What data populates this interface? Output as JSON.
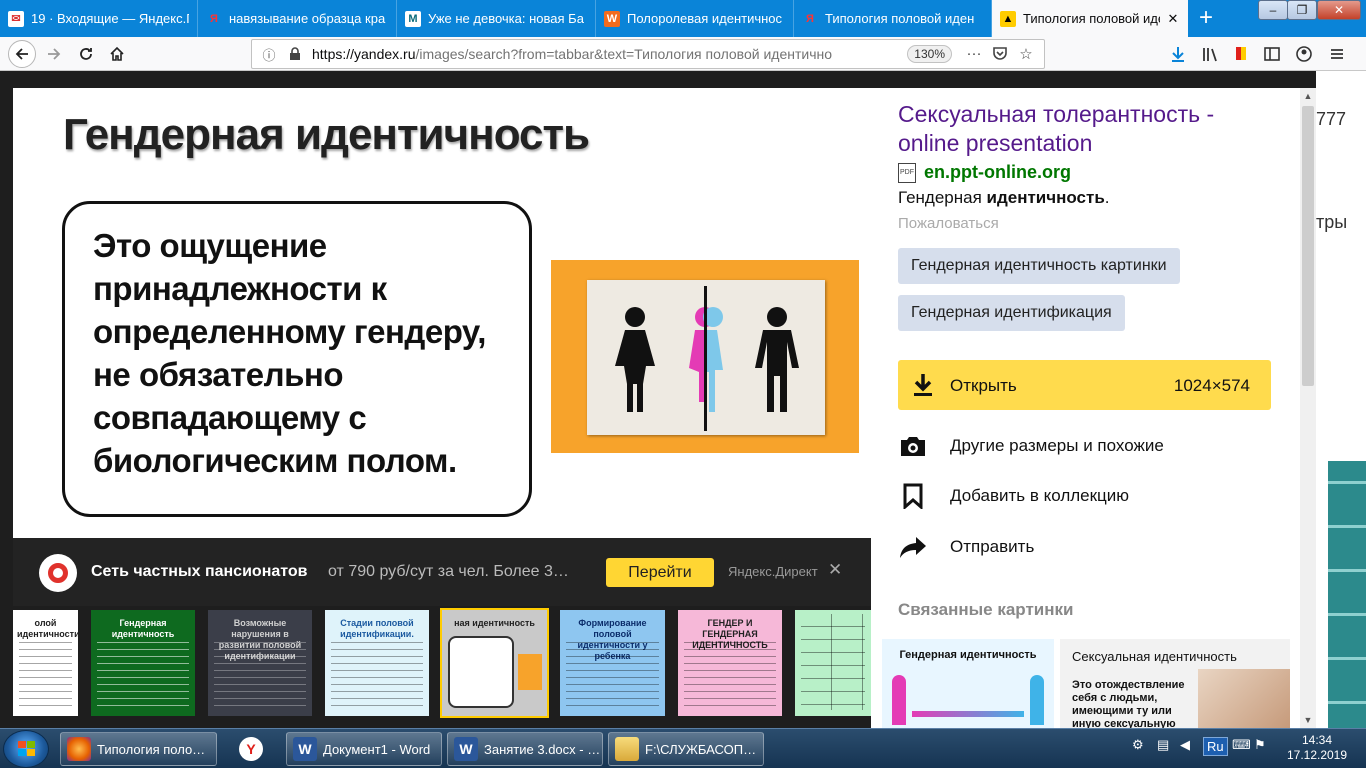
{
  "browser": {
    "tabs": [
      {
        "title": "19 · Входящие — Яндекс.По",
        "favicon": "mail-icon"
      },
      {
        "title": "навязывание образца кра",
        "favicon": "yandex-icon"
      },
      {
        "title": "Уже не девочка: новая Ба",
        "favicon": "m-icon"
      },
      {
        "title": "Полоролевая идентичнос",
        "favicon": "w-icon"
      },
      {
        "title": "Типология половой иден",
        "favicon": "yandex-icon"
      },
      {
        "title": "Типология половой иден",
        "favicon": "yandex-images-icon",
        "active": true
      }
    ],
    "url_host": "https://yandex.ru",
    "url_rest": "/images/search?from=tabbar&text=Типология половой идентичности п",
    "zoom": "130%"
  },
  "page_edge": {
    "number_text": "777",
    "text2": "тры"
  },
  "slide": {
    "title": "Гендерная идентичность",
    "text": "Это ощущение принадлежности к определенному гендеру, не обязательно совпадающему с биологическим полом.",
    "pic_colors": {
      "frame": "#f7a32b",
      "woman": "#111111",
      "split_pink": "#e43bb5",
      "split_blue": "#7ec8ea",
      "man": "#111111"
    }
  },
  "ad": {
    "title": "Сеть частных пансионатов",
    "description": "от 790 руб/сут за чел. Более 3…",
    "button": "Перейти",
    "source": "Яндекс.Директ"
  },
  "thumbnails": [
    {
      "title": "олой идентичности",
      "bg": "#ffffff",
      "fg": "#222222"
    },
    {
      "title": "Гендерная идентичность",
      "bg": "#0e6a1f",
      "fg": "#ffffff"
    },
    {
      "title": "Возможные нарушения в развитии половой идентификации",
      "bg": "#3b3e49",
      "fg": "#d0d0d0"
    },
    {
      "title": "Стадии половой идентификации.",
      "bg": "#dff3fa",
      "fg": "#1c5aa0"
    },
    {
      "title": "ная идентичность",
      "bg": "#c9c9c9",
      "fg": "#222222"
    },
    {
      "title": "Формирование половой идентичности у ребенка",
      "bg": "#8ec6f0",
      "fg": "#0b2d6b"
    },
    {
      "title": "ГЕНДЕР И ГЕНДЕРНАЯ ИДЕНТИЧНОСТЬ",
      "bg": "#f6b8d8",
      "fg": "#222222"
    },
    {
      "title": "",
      "bg": "#b8f0c8",
      "fg": "#222222"
    }
  ],
  "panel": {
    "title": "Сексуальная толерантность - online presentation",
    "source_host": "en.ppt-online.org",
    "source_icon": "pdf-icon",
    "caption_plain": "Гендерная ",
    "caption_bold": "идентичность",
    "caption_end": ".",
    "report": "Пожаловаться",
    "tags": [
      "Гендерная идентичность картинки",
      "Гендерная идентификация"
    ],
    "open_label": "Открыть",
    "open_size": "1024×574",
    "actions": [
      {
        "label": "Другие размеры и похожие",
        "icon": "camera-search-icon"
      },
      {
        "label": "Добавить в коллекцию",
        "icon": "bookmark-icon"
      },
      {
        "label": "Отправить",
        "icon": "share-arrow-icon"
      }
    ],
    "related_heading": "Связанные картинки",
    "related": [
      {
        "title": "Гендерная идентичность",
        "bg": "#e8f6ff"
      },
      {
        "title": "Сексуальная идентичность",
        "sub": "Это отождествление себя с людьми, имеющими ту или иную сексуальную ориентацию, осознание",
        "bg": "#f2f2f2"
      }
    ]
  },
  "taskbar": {
    "items": [
      {
        "label": "Типология поло…",
        "icon": "firefox-icon",
        "color": "#e66000"
      },
      {
        "label": "",
        "icon": "yandex-browser-icon",
        "color": "#ffffff"
      },
      {
        "label": "Документ1 - Word",
        "icon": "word-icon",
        "color": "#2b579a"
      },
      {
        "label": "Занятие 3.docx - …",
        "icon": "word-icon",
        "color": "#2b579a"
      },
      {
        "label": "F:\\СЛУЖБАСОП…",
        "icon": "folder-icon",
        "color": "#e8c35a"
      }
    ],
    "language": "Ru",
    "time": "14:34",
    "date": "17.12.2019"
  }
}
